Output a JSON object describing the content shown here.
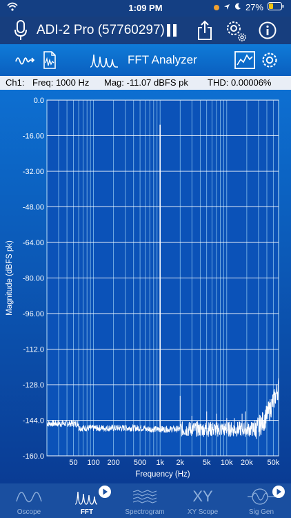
{
  "status": {
    "time": "1:09 PM",
    "battery": "27%"
  },
  "header": {
    "device": "ADI-2 Pro (57760297)"
  },
  "subbar": {
    "title": "FFT Analyzer"
  },
  "readout": {
    "channel": "Ch1:",
    "freq": "Freq: 1000 Hz",
    "mag": "Mag: -11.07 dBFS pk",
    "thd": "THD: 0.00006%"
  },
  "chart_data": {
    "type": "line",
    "xlabel": "Frequency (Hz)",
    "ylabel": "Magnitude (dBFS pk)",
    "xscale": "log",
    "xlim": [
      20,
      60000
    ],
    "ylim": [
      -160,
      0
    ],
    "y_ticks": [
      "0.0",
      "-16.00",
      "-32.00",
      "-48.00",
      "-64.00",
      "-80.00",
      "-96.00",
      "-112.0",
      "-128.0",
      "-144.0",
      "-160.0"
    ],
    "x_ticks": [
      "50",
      "100",
      "200",
      "500",
      "1k",
      "2k",
      "5k",
      "10k",
      "20k",
      "50k"
    ],
    "x_tick_values": [
      50,
      100,
      200,
      500,
      1000,
      2000,
      5000,
      10000,
      20000,
      50000
    ],
    "grid": true,
    "series": [
      {
        "peak_freq": 1000,
        "peak_value": -11.07,
        "noise_floor": -148
      }
    ],
    "spur_freqs": [
      2000,
      3000,
      5000,
      7000,
      10000,
      13000,
      17000,
      19000
    ],
    "spur_values": [
      -133,
      -142,
      -140,
      -141,
      -143,
      -143,
      -141,
      -140
    ],
    "tail": {
      "start_freq": 25000,
      "end_value": -129
    }
  },
  "tabs": [
    {
      "label": "Oscope"
    },
    {
      "label": "FFT"
    },
    {
      "label": "Spectrogram"
    },
    {
      "label": "XY Scope"
    },
    {
      "label": "Sig Gen"
    }
  ]
}
